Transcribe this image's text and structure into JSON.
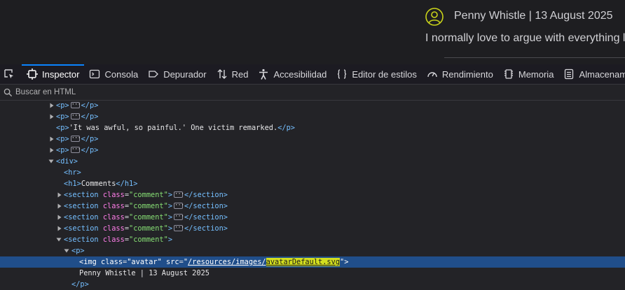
{
  "preview": {
    "meta": "Penny Whistle | 13 August 2025",
    "text": "I normally love to argue with everything l",
    "avatar_icon": "avatar-icon",
    "avatar_color": "#c9d31a"
  },
  "toolbar": {
    "picker_icon": "element-picker-icon",
    "tabs": [
      {
        "label": "Inspector",
        "icon": "inspector-icon"
      },
      {
        "label": "Consola",
        "icon": "console-icon"
      },
      {
        "label": "Depurador",
        "icon": "debugger-icon"
      },
      {
        "label": "Red",
        "icon": "network-icon"
      },
      {
        "label": "Accesibilidad",
        "icon": "accessibility-icon"
      },
      {
        "label": "Editor de estilos",
        "icon": "style-editor-icon"
      },
      {
        "label": "Rendimiento",
        "icon": "performance-icon"
      },
      {
        "label": "Memoria",
        "icon": "memory-icon"
      },
      {
        "label": "Almacenamiento",
        "icon": "storage-icon"
      }
    ],
    "active_tab": "Inspector",
    "accent": "#0a84ff"
  },
  "search": {
    "placeholder": "Buscar en HTML",
    "value": ""
  },
  "tree": {
    "rows": [
      {
        "p_open": "<p>",
        "p_close": "</p>"
      },
      {
        "p_open": "<p>",
        "p_close": "</p>"
      },
      {
        "p_open": "<p>",
        "text": "'It was awful, so painful.' One victim remarked.",
        "p_close": "</p>"
      },
      {
        "p_open": "<p>",
        "p_close": "</p>"
      },
      {
        "p_open": "<p>",
        "p_close": "</p>"
      },
      {
        "div_open": "<div>"
      },
      {
        "hr": "<hr>"
      },
      {
        "h1_open": "<h1>",
        "h1_text": "Comments",
        "h1_close": "</h1>"
      },
      {
        "section_open": "<section",
        "attr": "class",
        "value": "\"comment\"",
        "close": "</section>"
      },
      {
        "section_open": "<section",
        "attr": "class",
        "value": "\"comment\"",
        "close": "</section>"
      },
      {
        "section_open": "<section",
        "attr": "class",
        "value": "\"comment\"",
        "close": "</section>"
      },
      {
        "section_open": "<section",
        "attr": "class",
        "value": "\"comment\"",
        "close": "</section>"
      },
      {
        "section_open": "<section",
        "attr": "class",
        "value": "\"comment\"",
        "end": ">"
      },
      {
        "p": "<p>"
      },
      {
        "img_open": "<img",
        "attr1": "class",
        "value1": "\"avatar\"",
        "attr2": "src",
        "q": "\"",
        "path": "/resources/images/",
        "file": "avatarDefault.svg",
        "end": "\">"
      },
      {
        "text": "Penny Whistle | 13 August 2025"
      },
      {
        "p_close": "</p>"
      }
    ],
    "selection_color": "#204e8a",
    "highlight_color": "#d2de1f"
  }
}
